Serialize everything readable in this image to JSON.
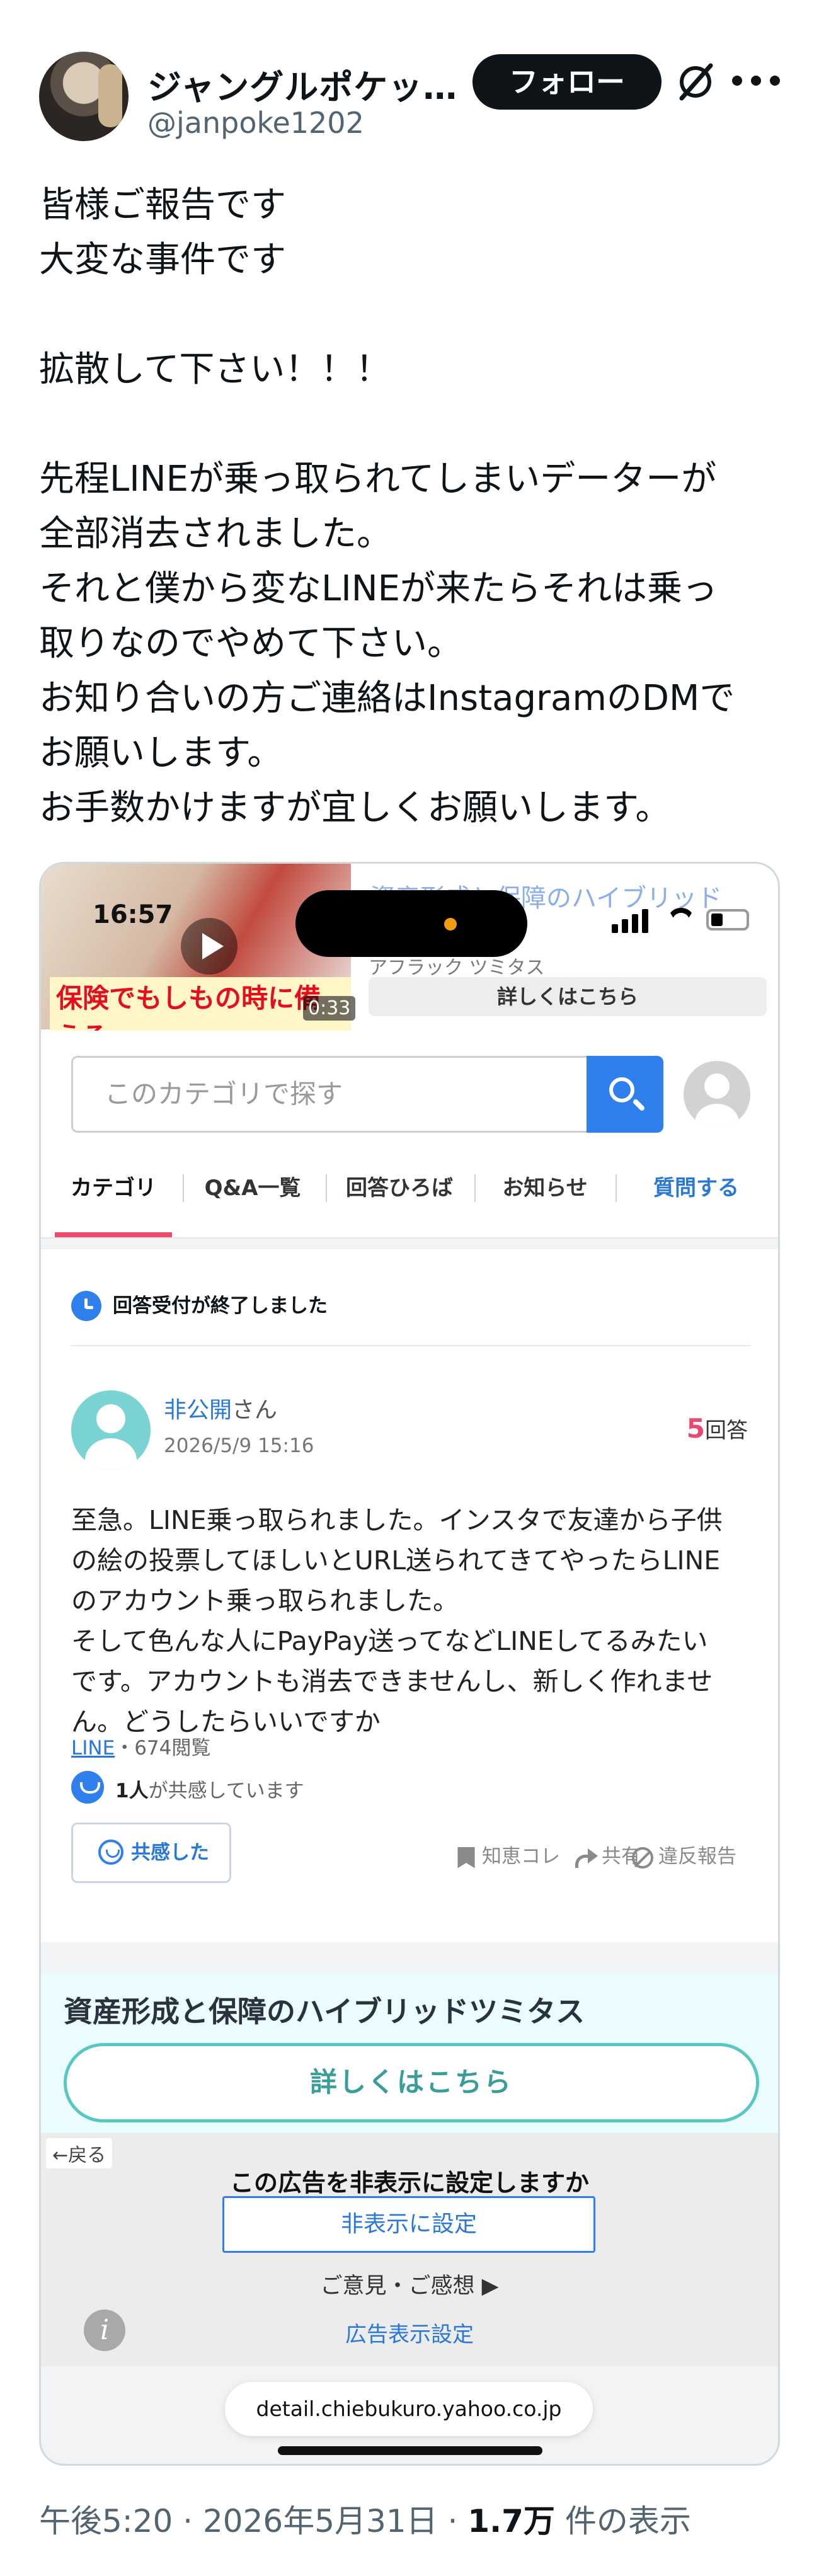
{
  "author": {
    "display_name": "ジャングルポケッ…",
    "handle": "@janpoke1202",
    "follow_label": "フォロー"
  },
  "tweet": {
    "lines": [
      "皆様ご報告です",
      "大変な事件です",
      "",
      "拡散して下さい！！！",
      "",
      "先程LINEが乗っ取られてしまいデーターが",
      "全部消去されました。",
      "それと僕から変なLINEが来たらそれは乗っ",
      "取りなのでやめて下さい。",
      "お知り合いの方ご連絡はInstagramのDMで",
      "お願いします。",
      "お手数かけますが宜しくお願いします。"
    ],
    "time": "午後5:20",
    "date": "2026年5月31日",
    "views": "1.7万",
    "views_suffix": "件の表示"
  },
  "screenshot": {
    "ad_top": {
      "video_time": "16:57",
      "video_banner": "保険でもしもの時に備える",
      "video_duration": "0:33",
      "headline": "資産形成と保障のハイブリッド",
      "sponsor": "アフラック ツミタス",
      "detail_button": "詳しくはこちら"
    },
    "search": {
      "placeholder": "このカテゴリで探す"
    },
    "tabs": [
      {
        "label": "カテゴリ"
      },
      {
        "label": "Q&A一覧"
      },
      {
        "label": "回答ひろば"
      },
      {
        "label": "お知らせ"
      },
      {
        "label": "質問する"
      }
    ],
    "question": {
      "closed_notice": "回答受付が終了しました",
      "user": "非公開",
      "user_suffix": "さん",
      "date": "2026/5/9 15:16",
      "answer_count": "5",
      "answer_suffix": "回答",
      "body_lines": [
        "至急。LINE乗っ取られました。インスタで友達から子供",
        "の絵の投票してほしいとURL送られてきてやったらLINE",
        "のアカウント乗っ取られました。",
        "そして色んな人にPayPay送ってなどLINEしてるみたい",
        "です。アカウントも消去できませんし、新しく作れませ",
        "ん。どうしたらいいですか"
      ],
      "tag": "LINE",
      "tag_views": "・674閲覧",
      "empathy_count": "1人",
      "empathy_suffix": "が共感しています",
      "empathy_button": "共感した",
      "bookmark_label": "知恵コレ",
      "share_label": "共有",
      "report_label": "違反報告"
    },
    "ad_bottom": {
      "title": "資産形成と保障のハイブリッドツミタス",
      "button": "詳しくはこちら",
      "back_label": "←戻る",
      "hide_question": "この広告を非表示に設定しますか",
      "hide_button": "非表示に設定",
      "feedback": "ご意見・ご感想 ▶",
      "ad_settings": "広告表示設定"
    },
    "url": "detail.chiebukuro.yahoo.co.jp"
  },
  "colors": {
    "follow_bg": "#0f1419",
    "link_blue": "#2a78d6",
    "tab_active": "#e84d6d",
    "answer_count": "#e8486d",
    "ad_button_border": "#56c8c0"
  }
}
